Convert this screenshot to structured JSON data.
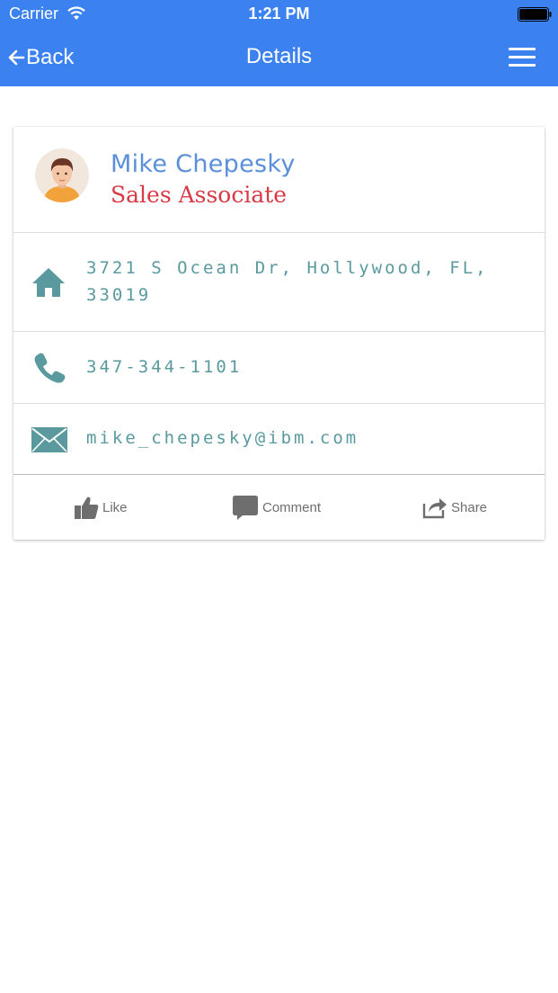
{
  "status_bar": {
    "carrier": "Carrier",
    "time": "1:21 PM"
  },
  "nav": {
    "back_label": "Back",
    "title": "Details"
  },
  "contact": {
    "name": "Mike Chepesky",
    "title": "Sales Associate",
    "address": "3721 S Ocean Dr, Hollywood, FL, 33019",
    "phone": "347-344-1101",
    "email": "mike_chepesky@ibm.com"
  },
  "actions": {
    "like": "Like",
    "comment": "Comment",
    "share": "Share"
  },
  "colors": {
    "header_bg": "#3b82f0",
    "name": "#5b8fd9",
    "job_title": "#d83a45",
    "info_text": "#5a9a9e",
    "icon": "#5a9a9e",
    "action": "#6e6e6e"
  }
}
